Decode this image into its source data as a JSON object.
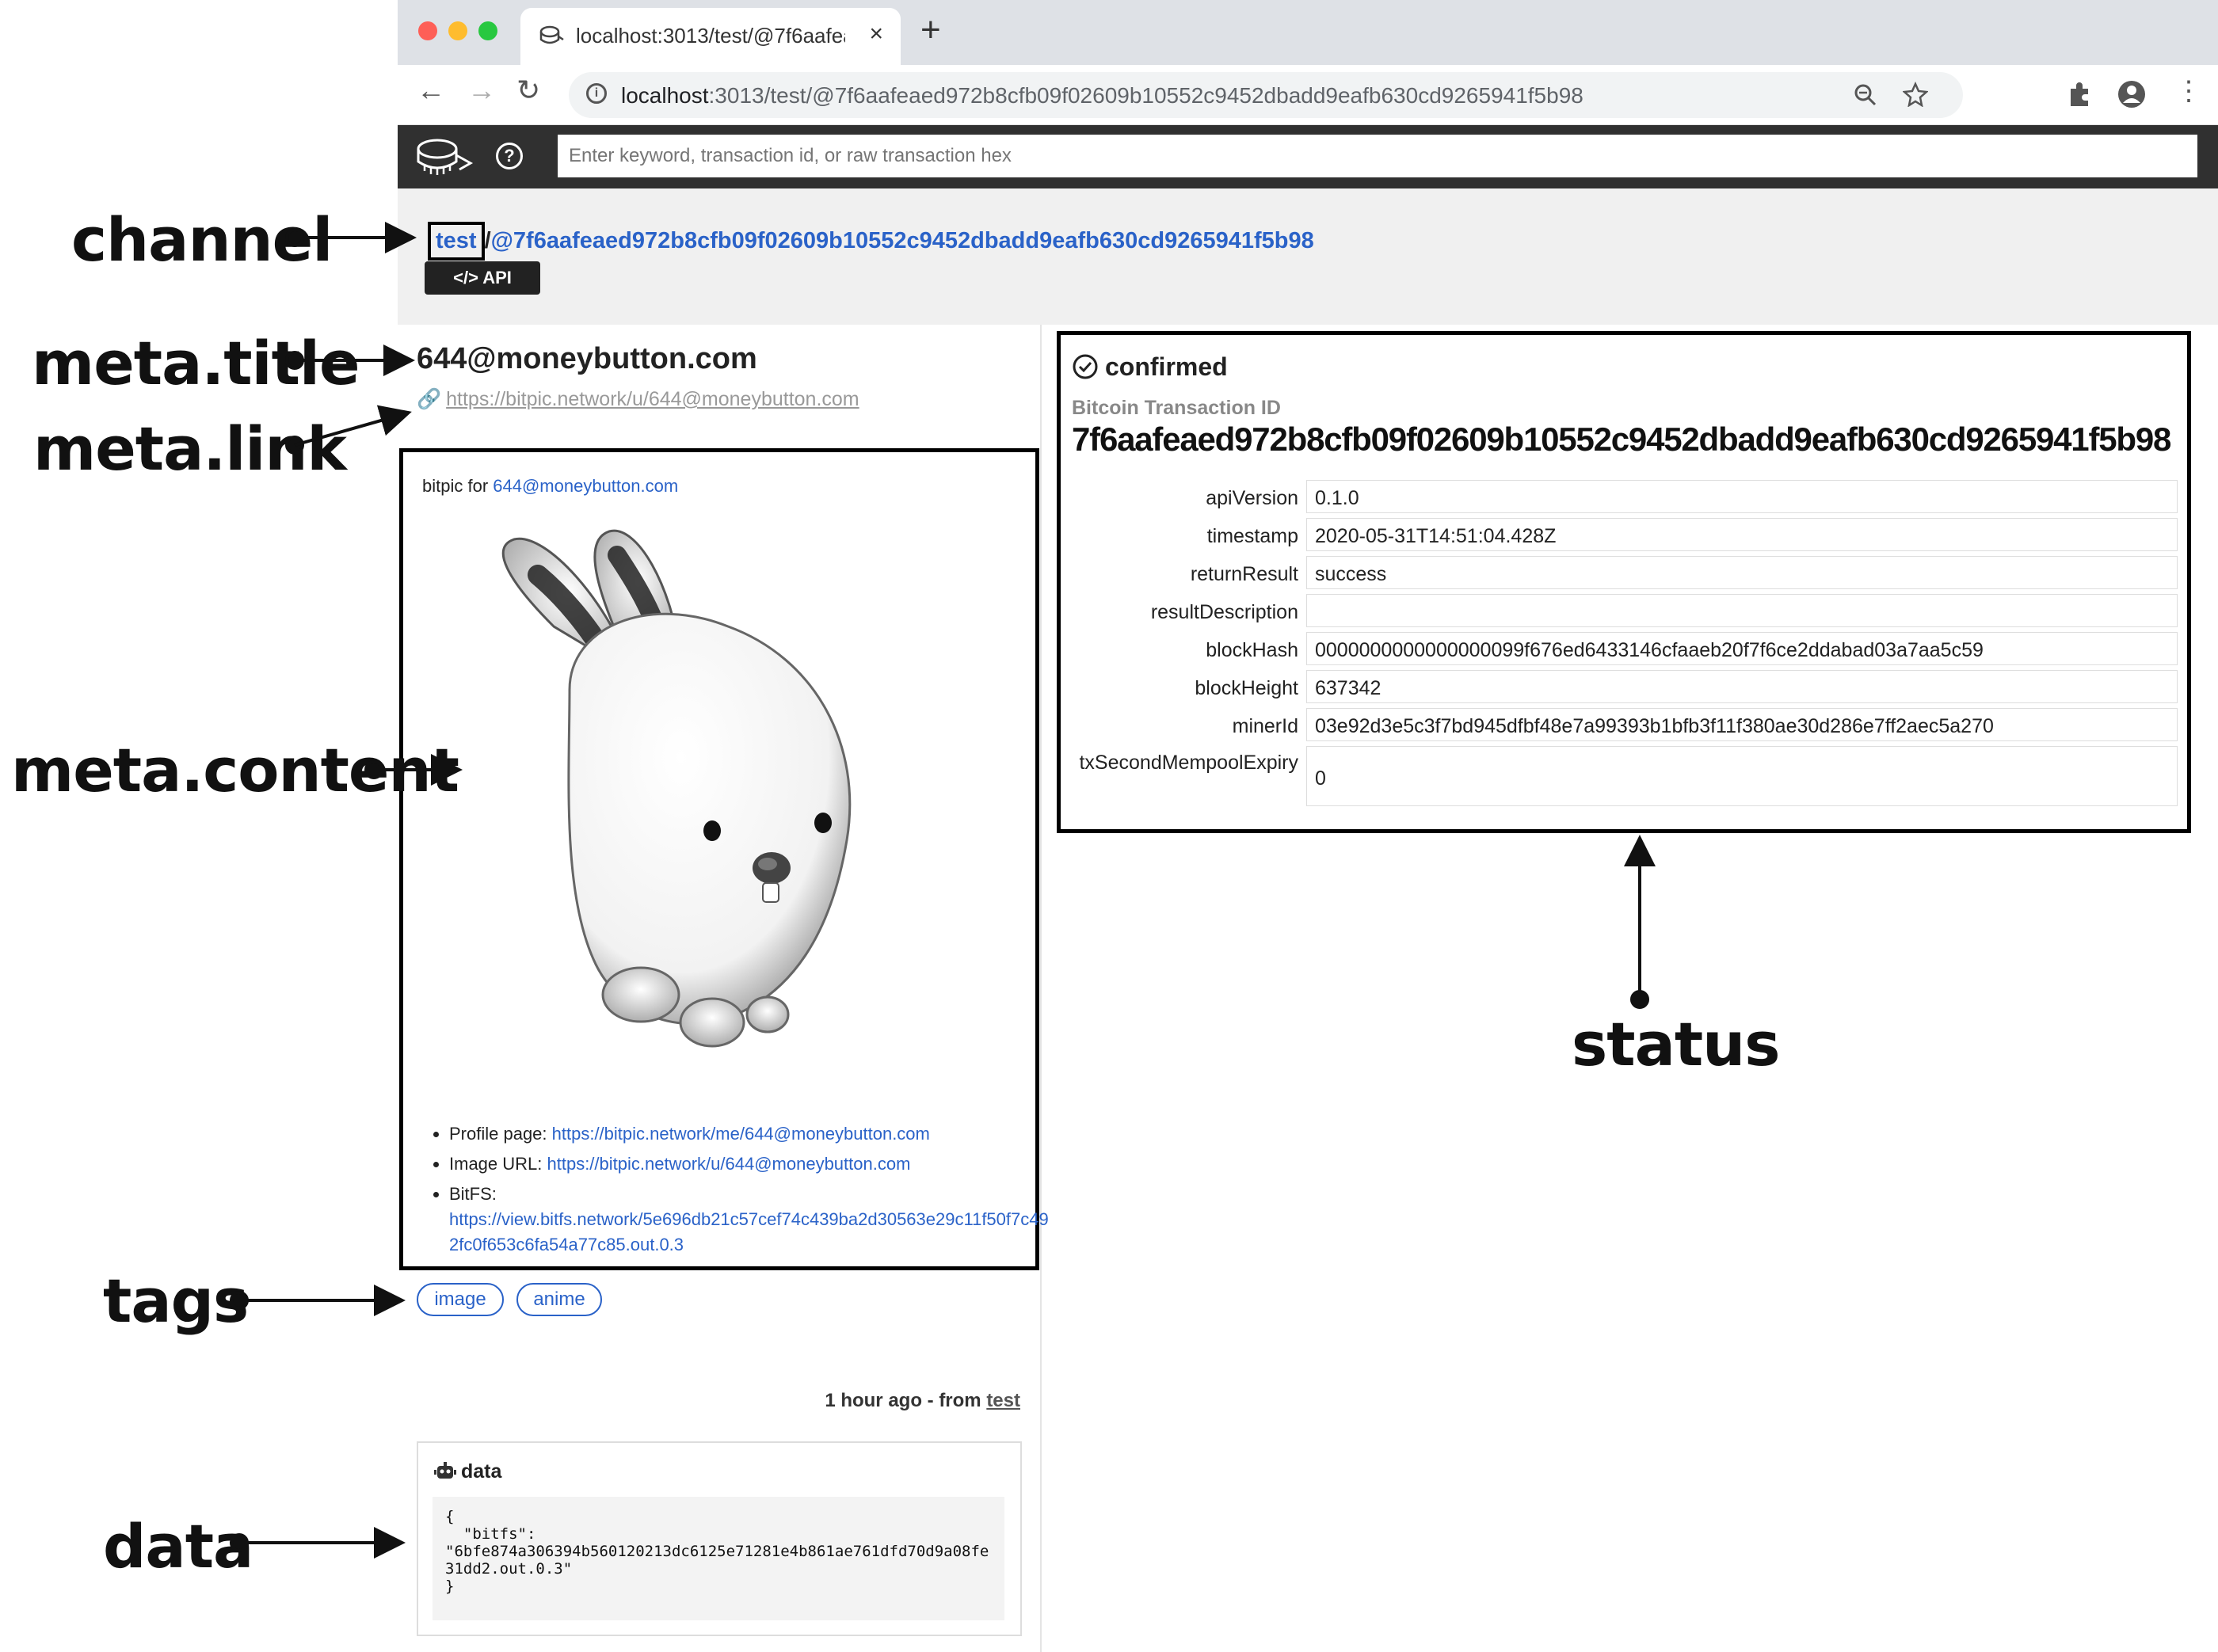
{
  "browser": {
    "tab_title": "localhost:3013/test/@7f6aafea",
    "tab_close": "×",
    "new_tab": "+",
    "back": "←",
    "forward": "→",
    "reload": "↻",
    "url_host": "localhost",
    "url_path": ":3013/test/@7f6aafeaed972b8cfb09f02609b10552c9452dbadd9eafb630cd9265941f5b98",
    "menu": "⋮",
    "traffic_lights": [
      "#fe5f57",
      "#febc2e",
      "#28c840"
    ]
  },
  "app": {
    "help_icon": "?",
    "search_placeholder": "Enter keyword, transaction id, or raw transaction hex"
  },
  "breadcrumb": {
    "channel": "test",
    "separator": "/",
    "tx": "@7f6aafeaed972b8cfb09f02609b10552c9452dbadd9eafb630cd9265941f5b98",
    "api_button": "</> API"
  },
  "meta": {
    "title": "644@moneybutton.com",
    "link": "https://bitpic.network/u/644@moneybutton.com",
    "caption_prefix": "bitpic for ",
    "caption_link": "644@moneybutton.com",
    "items": [
      {
        "label": "Profile page: ",
        "value": "https://bitpic.network/me/644@moneybutton.com"
      },
      {
        "label": "Image URL: ",
        "value": "https://bitpic.network/u/644@moneybutton.com"
      },
      {
        "label": "BitFS: ",
        "value": "https://view.bitfs.network/5e696db21c57cef74c439ba2d30563e29c11f50f7c492fc0f653c6fa54a77c85.out.0.3"
      }
    ]
  },
  "tags": [
    "image",
    "anime"
  ],
  "footer": {
    "time": "1 hour ago - from ",
    "source": "test"
  },
  "data_panel": {
    "title": "data",
    "json": "{\n  \"bitfs\":\n\"6bfe874a306394b560120213dc6125e71281e4b861ae761dfd70d9a08fe31dd2.out.0.3\"\n}"
  },
  "status": {
    "state": "confirmed",
    "id_label": "Bitcoin Transaction ID",
    "txid": "7f6aafeaed972b8cfb09f02609b10552c9452dbadd9eafb630cd9265941f5b98",
    "rows": [
      {
        "key": "apiVersion",
        "value": "0.1.0"
      },
      {
        "key": "timestamp",
        "value": "2020-05-31T14:51:04.428Z"
      },
      {
        "key": "returnResult",
        "value": "success"
      },
      {
        "key": "resultDescription",
        "value": ""
      },
      {
        "key": "blockHash",
        "value": "0000000000000000099f676ed6433146cfaaeb20f7f6ce2ddabad03a7aa5c59"
      },
      {
        "key": "blockHeight",
        "value": "637342"
      },
      {
        "key": "minerId",
        "value": "03e92d3e5c3f7bd945dfbf48e7a99393b1bfb3f11f380ae30d286e7ff2aec5a270"
      },
      {
        "key": "txSecondMempoolExpiry",
        "value": "0"
      }
    ]
  },
  "annotations": {
    "channel": "channel",
    "meta_title": "meta.title",
    "meta_link": "meta.link",
    "meta_content": "meta.content",
    "tags": "tags",
    "data": "data",
    "status": "status"
  }
}
